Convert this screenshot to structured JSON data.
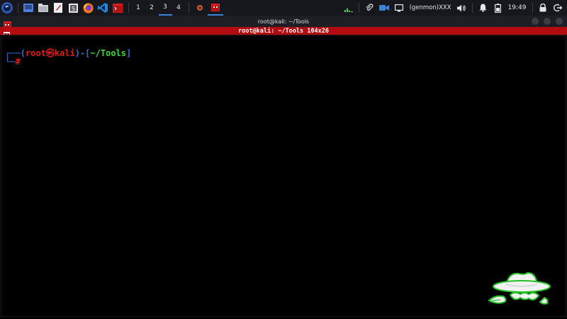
{
  "panel": {
    "workspaces": [
      "1",
      "2",
      "3",
      "4"
    ],
    "active_workspace": "3",
    "genmon_label": "(genmon)XXX",
    "clock": "19:49"
  },
  "window": {
    "title": "root@kali: ~/Tools",
    "tab_title": "root@kali: ~/Tools 104x26"
  },
  "terminal": {
    "prompt_user": "root",
    "prompt_at": "㉿",
    "prompt_host": "kali",
    "prompt_dir": "~/Tools",
    "prompt_hash": "#"
  },
  "colors": {
    "accent": "#b40b10",
    "prompt_blue": "#2f6fd6",
    "prompt_red": "#e01818",
    "prompt_green": "#3ddc3d",
    "workspace_underline": "#3a82d6"
  },
  "icons": [
    "kali-menu-icon",
    "show-desktop-icon",
    "file-manager-icon",
    "text-editor-icon",
    "burp-icon",
    "firefox-icon",
    "vscode-icon",
    "terminal-icon",
    "paperclip-icon",
    "camera-icon",
    "display-icon",
    "volume-icon",
    "bell-icon",
    "battery-icon",
    "lock-icon",
    "logout-icon",
    "incognito-logo-icon"
  ]
}
